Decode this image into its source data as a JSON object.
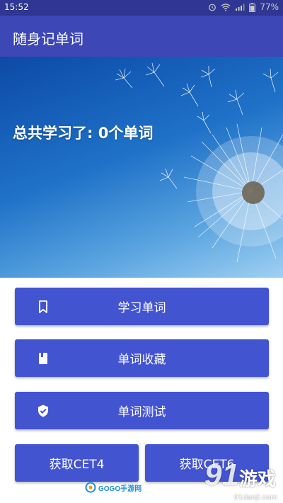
{
  "status_bar": {
    "time": "15:52",
    "battery": "77%"
  },
  "app_bar": {
    "title": "随身记单词"
  },
  "hero": {
    "text": "总共学习了: 0个单词"
  },
  "buttons": {
    "learn": "学习单词",
    "favorites": "单词收藏",
    "test": "单词测试",
    "cet4": "获取CET4",
    "cet6": "获取CET6"
  },
  "watermarks": {
    "gogo": "GOGO手游网",
    "site_num": "91",
    "site_cn": "游戏",
    "site_domain": "91danji.com"
  },
  "colors": {
    "primary": "#3d47b5",
    "status": "#2f3792",
    "button": "#4354d1"
  }
}
